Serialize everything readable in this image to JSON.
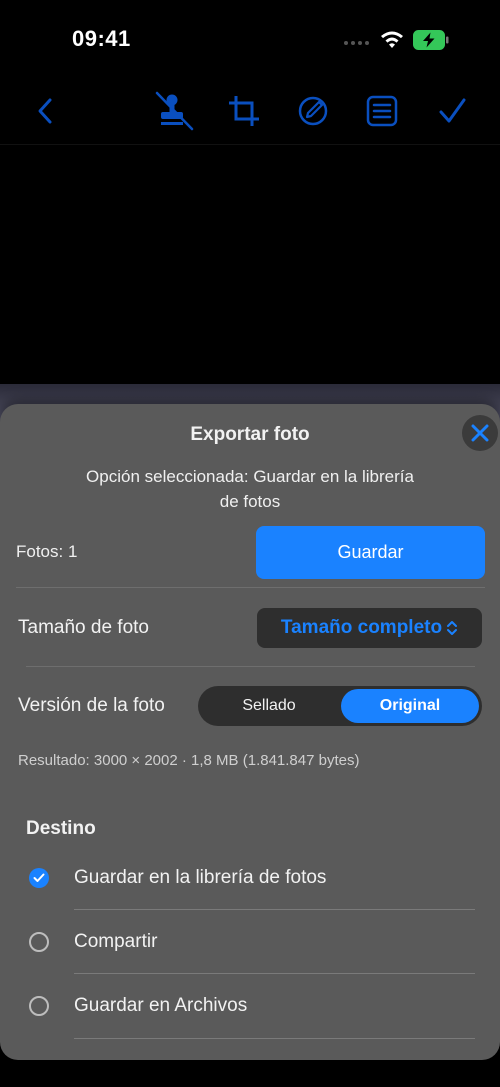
{
  "status_bar": {
    "time": "09:41",
    "icons": [
      "cellular-dots-icon",
      "wifi-icon",
      "battery-charging-icon"
    ]
  },
  "toolbar": {
    "icons": [
      "back-chevron-icon",
      "seal-off-icon",
      "crop-icon",
      "markup-icon",
      "list-icon",
      "checkmark-icon"
    ]
  },
  "sheet": {
    "title": "Exportar foto",
    "selected_option_line1": "Opción seleccionada: Guardar en la librería",
    "selected_option_line2": "de fotos",
    "photos_count": "Fotos: 1",
    "save_label": "Guardar",
    "size_label": "Tamaño de foto",
    "size_value": "Tamaño completo",
    "version_label": "Versión de la foto",
    "version_options": [
      "Sellado",
      "Original"
    ],
    "version_selected": "Original",
    "result": "Resultado: 3000 × 2002 · 1,8 MB (1.841.847 bytes)",
    "destination_title": "Destino",
    "destinations": [
      {
        "label": "Guardar en la librería de fotos",
        "selected": true
      },
      {
        "label": "Compartir",
        "selected": false
      },
      {
        "label": "Guardar en Archivos",
        "selected": false
      }
    ]
  },
  "colors": {
    "accent": "#1a82ff",
    "sheet_bg": "#5a5a5a",
    "control_bg": "#2e2e2e",
    "battery": "#34c759"
  }
}
